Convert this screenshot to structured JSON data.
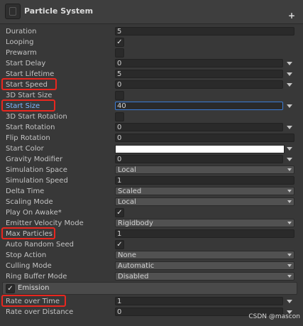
{
  "header": {
    "title": "Particle System",
    "plus_icon": "+"
  },
  "rows": {
    "duration": {
      "label": "Duration",
      "value": "5"
    },
    "looping": {
      "label": "Looping",
      "checked": true
    },
    "prewarm": {
      "label": "Prewarm",
      "checked": false
    },
    "start_delay": {
      "label": "Start Delay",
      "value": "0"
    },
    "start_lifetime": {
      "label": "Start Lifetime",
      "value": "5"
    },
    "start_speed": {
      "label": "Start Speed",
      "value": "0"
    },
    "start_size_3d": {
      "label": "3D Start Size",
      "checked": false
    },
    "start_size": {
      "label": "Start Size",
      "value": "40"
    },
    "start_rotation_3d": {
      "label": "3D Start Rotation",
      "checked": false
    },
    "start_rotation": {
      "label": "Start Rotation",
      "value": "0"
    },
    "flip_rotation": {
      "label": "Flip Rotation",
      "value": "0"
    },
    "start_color": {
      "label": "Start Color",
      "color": "#ffffff"
    },
    "gravity_modifier": {
      "label": "Gravity Modifier",
      "value": "0"
    },
    "simulation_space": {
      "label": "Simulation Space",
      "value": "Local"
    },
    "simulation_speed": {
      "label": "Simulation Speed",
      "value": "1"
    },
    "delta_time": {
      "label": "Delta Time",
      "value": "Scaled"
    },
    "scaling_mode": {
      "label": "Scaling Mode",
      "value": "Local"
    },
    "play_on_awake": {
      "label": "Play On Awake*",
      "checked": true
    },
    "emitter_velocity_mode": {
      "label": "Emitter Velocity Mode",
      "value": "Rigidbody"
    },
    "max_particles": {
      "label": "Max Particles",
      "value": "1"
    },
    "auto_random_seed": {
      "label": "Auto Random Seed",
      "checked": true
    },
    "stop_action": {
      "label": "Stop Action",
      "value": "None"
    },
    "culling_mode": {
      "label": "Culling Mode",
      "value": "Automatic"
    },
    "ring_buffer_mode": {
      "label": "Ring Buffer Mode",
      "value": "Disabled"
    }
  },
  "emission": {
    "label": "Emission",
    "checked": true,
    "rate_over_time": {
      "label": "Rate over Time",
      "value": "1"
    },
    "rate_over_distance": {
      "label": "Rate over Distance",
      "value": "0"
    }
  },
  "check_glyph": "✓",
  "watermark": "CSDN @mascon",
  "colors": {
    "highlight": "#e8271f",
    "active_label": "#7eb7ff",
    "panel_bg": "#383838"
  }
}
